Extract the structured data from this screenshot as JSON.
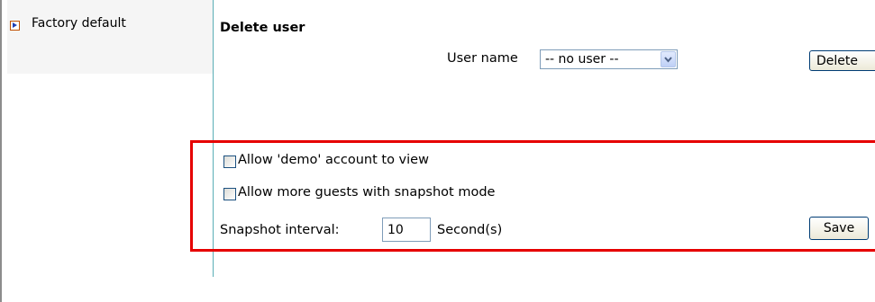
{
  "sidebar": {
    "items": [
      {
        "label": "Factory default",
        "icon": "arrow-right-icon"
      }
    ]
  },
  "delete_user": {
    "title": "Delete user",
    "username_label": "User name",
    "username_select_value": "-- no user --",
    "delete_button_label": "Delete"
  },
  "guest_settings": {
    "allow_demo_label": "Allow 'demo' account to view",
    "allow_demo_checked": false,
    "allow_guests_label": "Allow more guests with snapshot mode",
    "allow_guests_checked": false,
    "snapshot_interval_label": "Snapshot interval:",
    "snapshot_interval_value": "10",
    "snapshot_interval_unit": "Second(s)",
    "save_button_label": "Save"
  },
  "colors": {
    "highlight_frame": "#e60000",
    "divider": "#5aaeb6",
    "sidebar_row_bg": "#f5f5f5"
  }
}
